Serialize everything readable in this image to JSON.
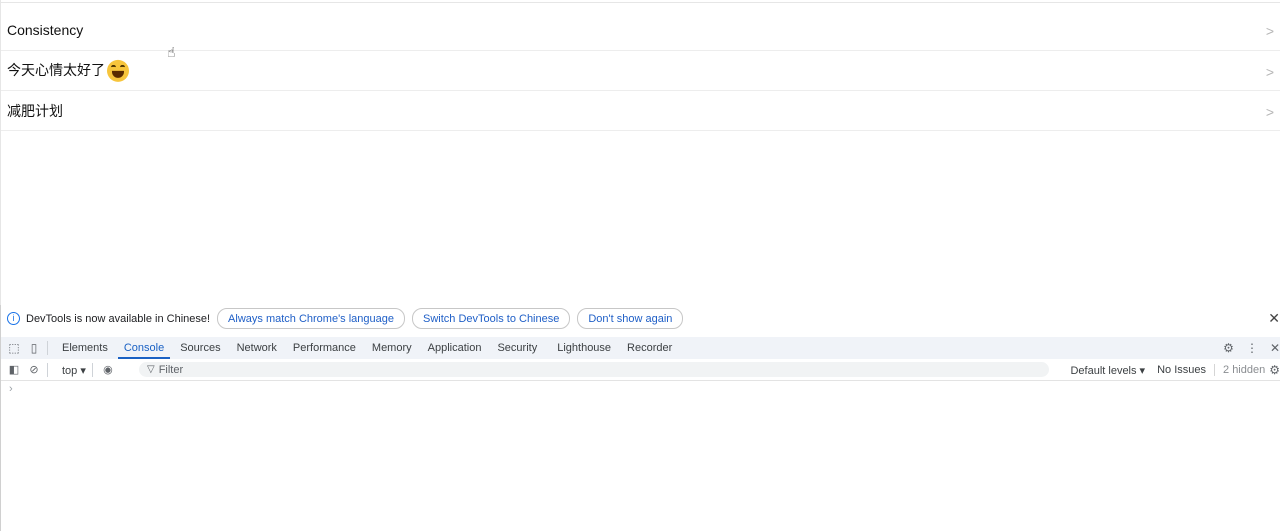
{
  "list": {
    "items": [
      {
        "label": "Consistency"
      },
      {
        "label": "今天心情太好了",
        "emoji": "laughing-emoji"
      },
      {
        "label": "减肥计划"
      }
    ],
    "chevron": ">"
  },
  "devtools": {
    "infobar": {
      "message": "DevTools is now available in Chinese!",
      "buttons": [
        "Always match Chrome's language",
        "Switch DevTools to Chinese",
        "Don't show again"
      ],
      "close": "✕"
    },
    "tabs": [
      "Elements",
      "Console",
      "Sources",
      "Network",
      "Performance",
      "Memory",
      "Application",
      "Security",
      "Lighthouse",
      "Recorder"
    ],
    "active_tab": "Console",
    "console": {
      "context": "top ▾",
      "filter_placeholder": "Filter",
      "default_levels": "Default levels ▾",
      "issues": "No Issues",
      "hidden": "2 hidden",
      "prompt": "›"
    },
    "colors": {
      "accent": "#1a61c4",
      "tabbar_bg": "#f0f3f8"
    }
  }
}
